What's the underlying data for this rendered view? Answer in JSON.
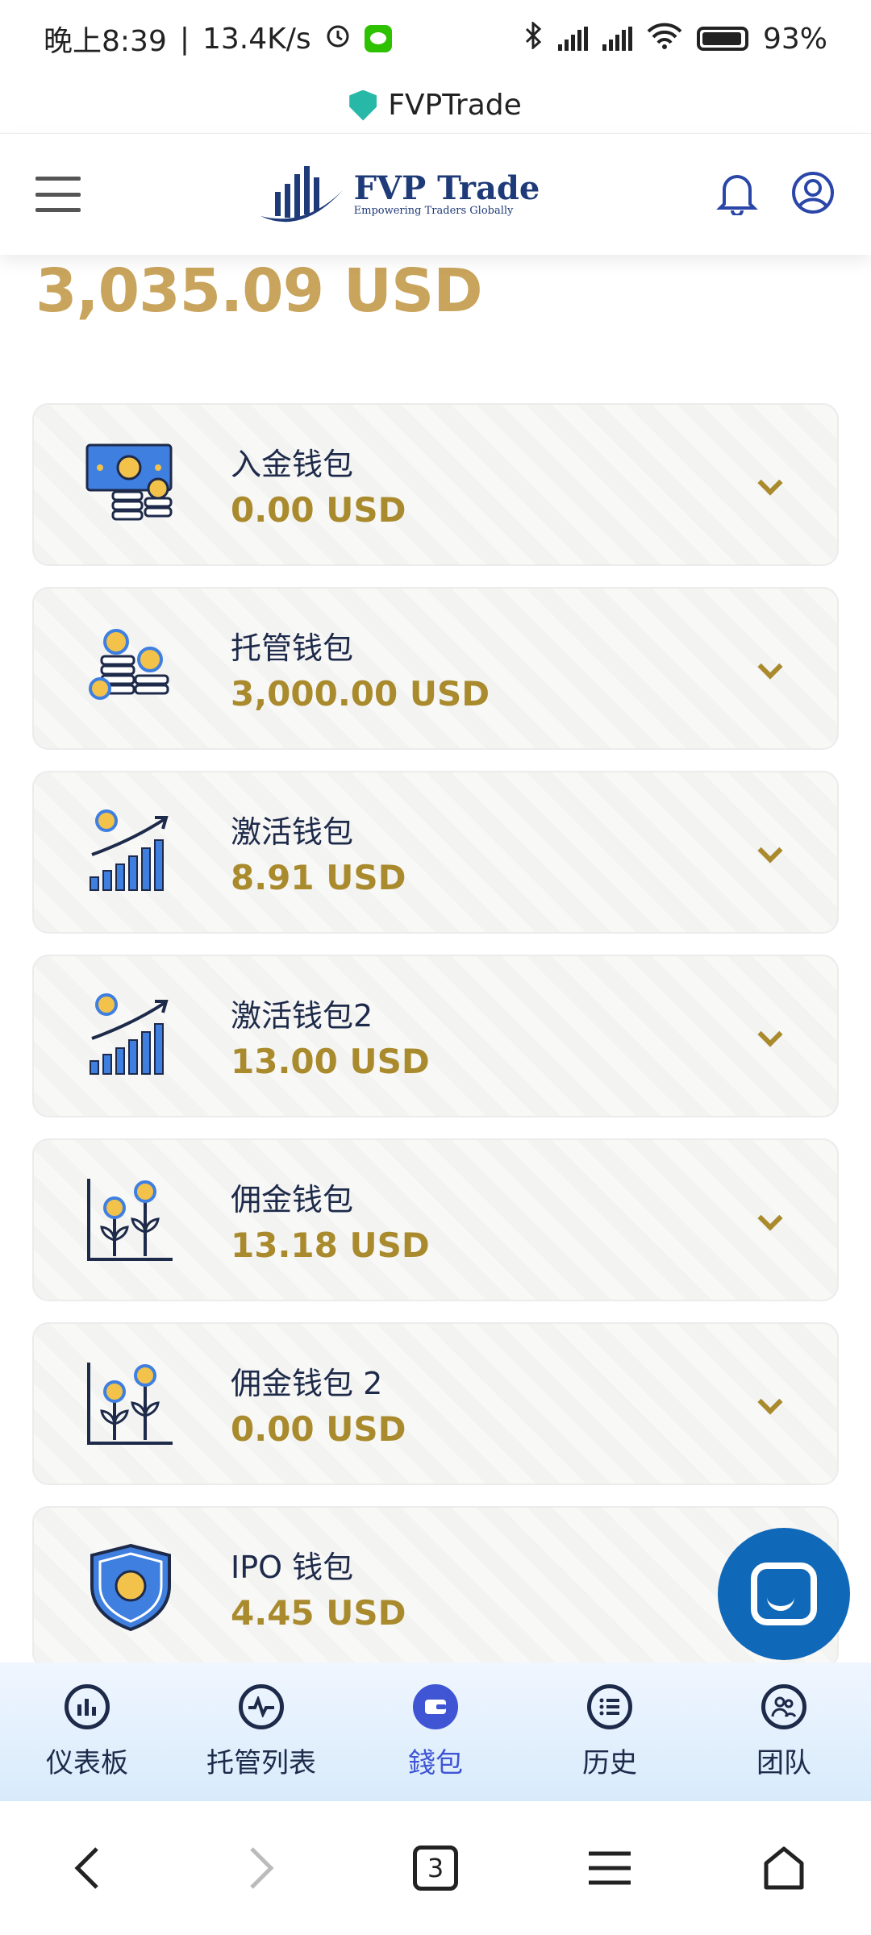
{
  "status_bar": {
    "time": "晚上8:39",
    "network_speed": "13.4K/s",
    "battery": "93%",
    "icons": [
      "alarm-icon",
      "wechat-icon",
      "bluetooth-icon",
      "signal-hd-icon",
      "signal-hd-icon",
      "wifi-icon",
      "battery-icon"
    ]
  },
  "title_bar": {
    "title": "FVPTrade"
  },
  "header": {
    "logo_title": "FVP Trade",
    "logo_subtitle": "Empowering Traders Globally",
    "icons": [
      "menu-icon",
      "bell-icon",
      "user-icon"
    ]
  },
  "balance": {
    "total": "3,035.09 USD"
  },
  "wallets": [
    {
      "name": "入金钱包",
      "amount": "0.00 USD",
      "icon": "cash-coins-icon"
    },
    {
      "name": "托管钱包",
      "amount": "3,000.00 USD",
      "icon": "coin-stack-icon"
    },
    {
      "name": "激活钱包",
      "amount": "8.91 USD",
      "icon": "growth-chart-icon"
    },
    {
      "name": "激活钱包2",
      "amount": "13.00 USD",
      "icon": "growth-chart-icon"
    },
    {
      "name": "佣金钱包",
      "amount": "13.18 USD",
      "icon": "money-plant-icon"
    },
    {
      "name": "佣金钱包 2",
      "amount": "0.00 USD",
      "icon": "money-plant-icon"
    },
    {
      "name": "IPO 钱包",
      "amount": "4.45 USD",
      "icon": "shield-coin-icon"
    }
  ],
  "bottom_nav": [
    {
      "label": "仪表板",
      "icon": "chart-icon",
      "active": false
    },
    {
      "label": "托管列表",
      "icon": "pulse-icon",
      "active": false
    },
    {
      "label": "錢包",
      "icon": "wallet-icon",
      "active": true
    },
    {
      "label": "历史",
      "icon": "list-icon",
      "active": false
    },
    {
      "label": "团队",
      "icon": "team-icon",
      "active": false
    }
  ],
  "browser_bar": {
    "tab_count": "3"
  },
  "colors": {
    "gold": "#c9a45c",
    "amount_gold": "#a98a2d",
    "navy": "#1e2a4a",
    "accent_blue": "#3f55d4",
    "chat_blue": "#1068b8"
  }
}
